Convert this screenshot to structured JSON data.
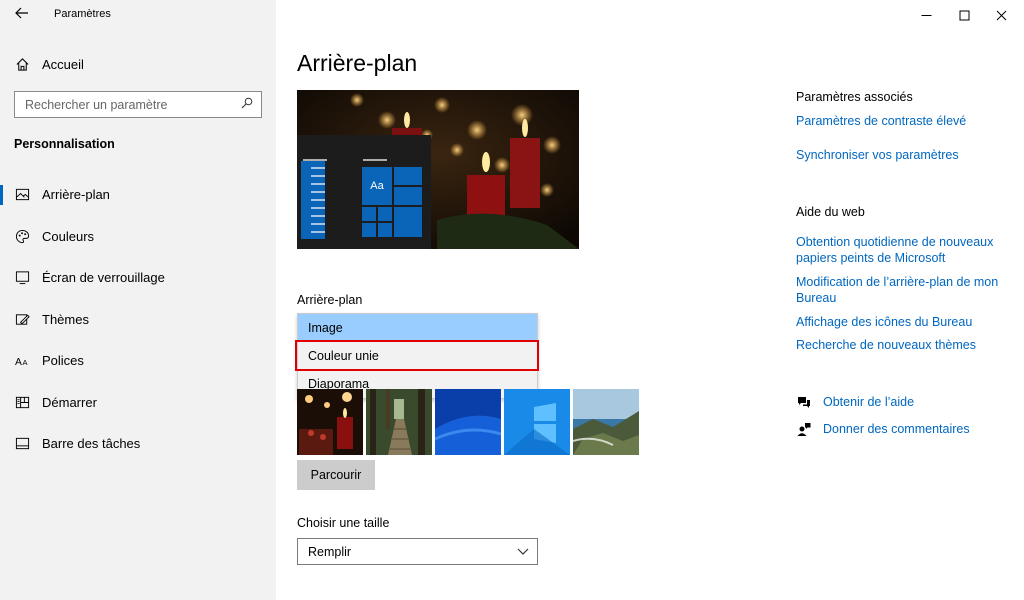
{
  "window": {
    "title": "Paramètres",
    "controls": [
      "minimize",
      "maximize",
      "close"
    ]
  },
  "sidebar": {
    "home_label": "Accueil",
    "search_placeholder": "Rechercher un paramètre",
    "section_title": "Personnalisation",
    "items": [
      {
        "label": "Arrière-plan",
        "icon": "picture-icon",
        "active": true
      },
      {
        "label": "Couleurs",
        "icon": "palette-icon",
        "active": false
      },
      {
        "label": "Écran de verrouillage",
        "icon": "lock-screen-icon",
        "active": false
      },
      {
        "label": "Thèmes",
        "icon": "themes-icon",
        "active": false
      },
      {
        "label": "Polices",
        "icon": "fonts-icon",
        "active": false
      },
      {
        "label": "Démarrer",
        "icon": "start-icon",
        "active": false
      },
      {
        "label": "Barre des tâches",
        "icon": "taskbar-icon",
        "active": false
      }
    ]
  },
  "main": {
    "title": "Arrière-plan",
    "preview_tile_text": "Aa",
    "background_label": "Arrière-plan",
    "dropdown_options": [
      {
        "label": "Image",
        "selected": true
      },
      {
        "label": "Couleur unie",
        "selected": false,
        "highlighted": true
      },
      {
        "label": "Diaporama",
        "selected": false
      }
    ],
    "browse_button": "Parcourir",
    "size_label": "Choisir une taille",
    "size_value": "Remplir"
  },
  "related": {
    "heading": "Paramètres associés",
    "links": [
      "Paramètres de contraste élevé",
      "Synchroniser vos paramètres"
    ]
  },
  "web_help": {
    "heading": "Aide du web",
    "links": [
      "Obtention quotidienne de nouveaux papiers peints de Microsoft",
      "Modification de l’arrière-plan de mon Bureau",
      "Affichage des icônes du Bureau",
      "Recherche de nouveaux thèmes"
    ]
  },
  "help": {
    "get_help": "Obtenir de l’aide",
    "feedback": "Donner des commentaires"
  },
  "colors": {
    "accent": "#0067c0",
    "selected_option": "#99ccff",
    "highlight_border": "#e00000",
    "sidebar_bg": "#f2f2f2"
  }
}
